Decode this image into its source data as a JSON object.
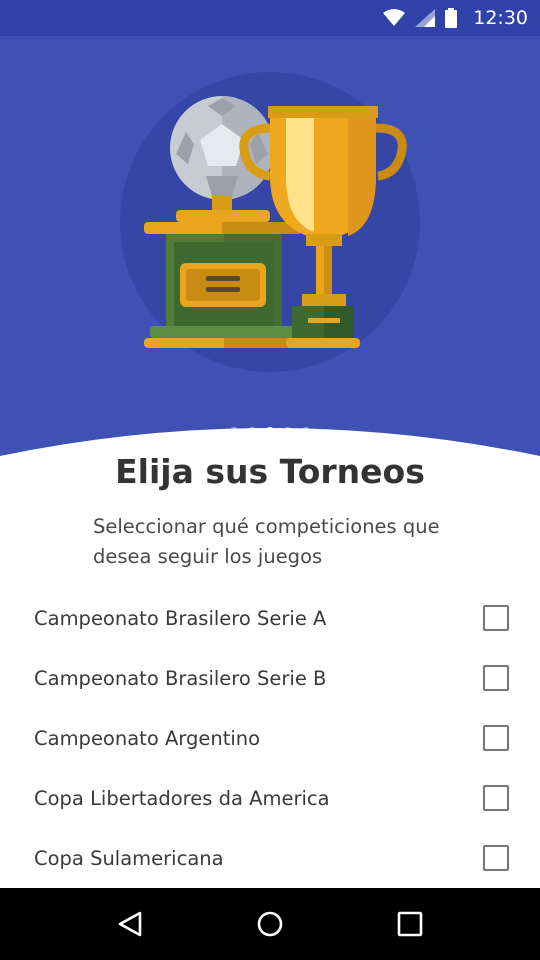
{
  "status_bar": {
    "time": "12:30",
    "icons": [
      "wifi-icon",
      "cellular-signal-icon",
      "battery-icon"
    ]
  },
  "onboarding": {
    "illustration": "trophy-and-soccer-ball-illustration",
    "page_indicator": {
      "count": 5,
      "active_index": 2
    },
    "title": "Elija sus Torneos",
    "subtitle": "Seleccionar qué competiciones que desea seguir los juegos"
  },
  "tournaments": [
    {
      "label": "Campeonato Brasilero Serie A",
      "checked": false
    },
    {
      "label": "Campeonato Brasilero Serie B",
      "checked": false
    },
    {
      "label": "Campeonato Argentino",
      "checked": false
    },
    {
      "label": "Copa Libertadores da America",
      "checked": false
    },
    {
      "label": "Copa Sulamericana",
      "checked": false
    }
  ],
  "nav_bar": {
    "buttons": [
      "back-icon",
      "home-icon",
      "recents-icon"
    ]
  },
  "colors": {
    "primary": "#3f51b5",
    "status_bar": "#3041a8",
    "trophy_gold": "#f0a91e",
    "base_green": "#4e7d3a",
    "ball_silver": "#c7ccd3"
  }
}
